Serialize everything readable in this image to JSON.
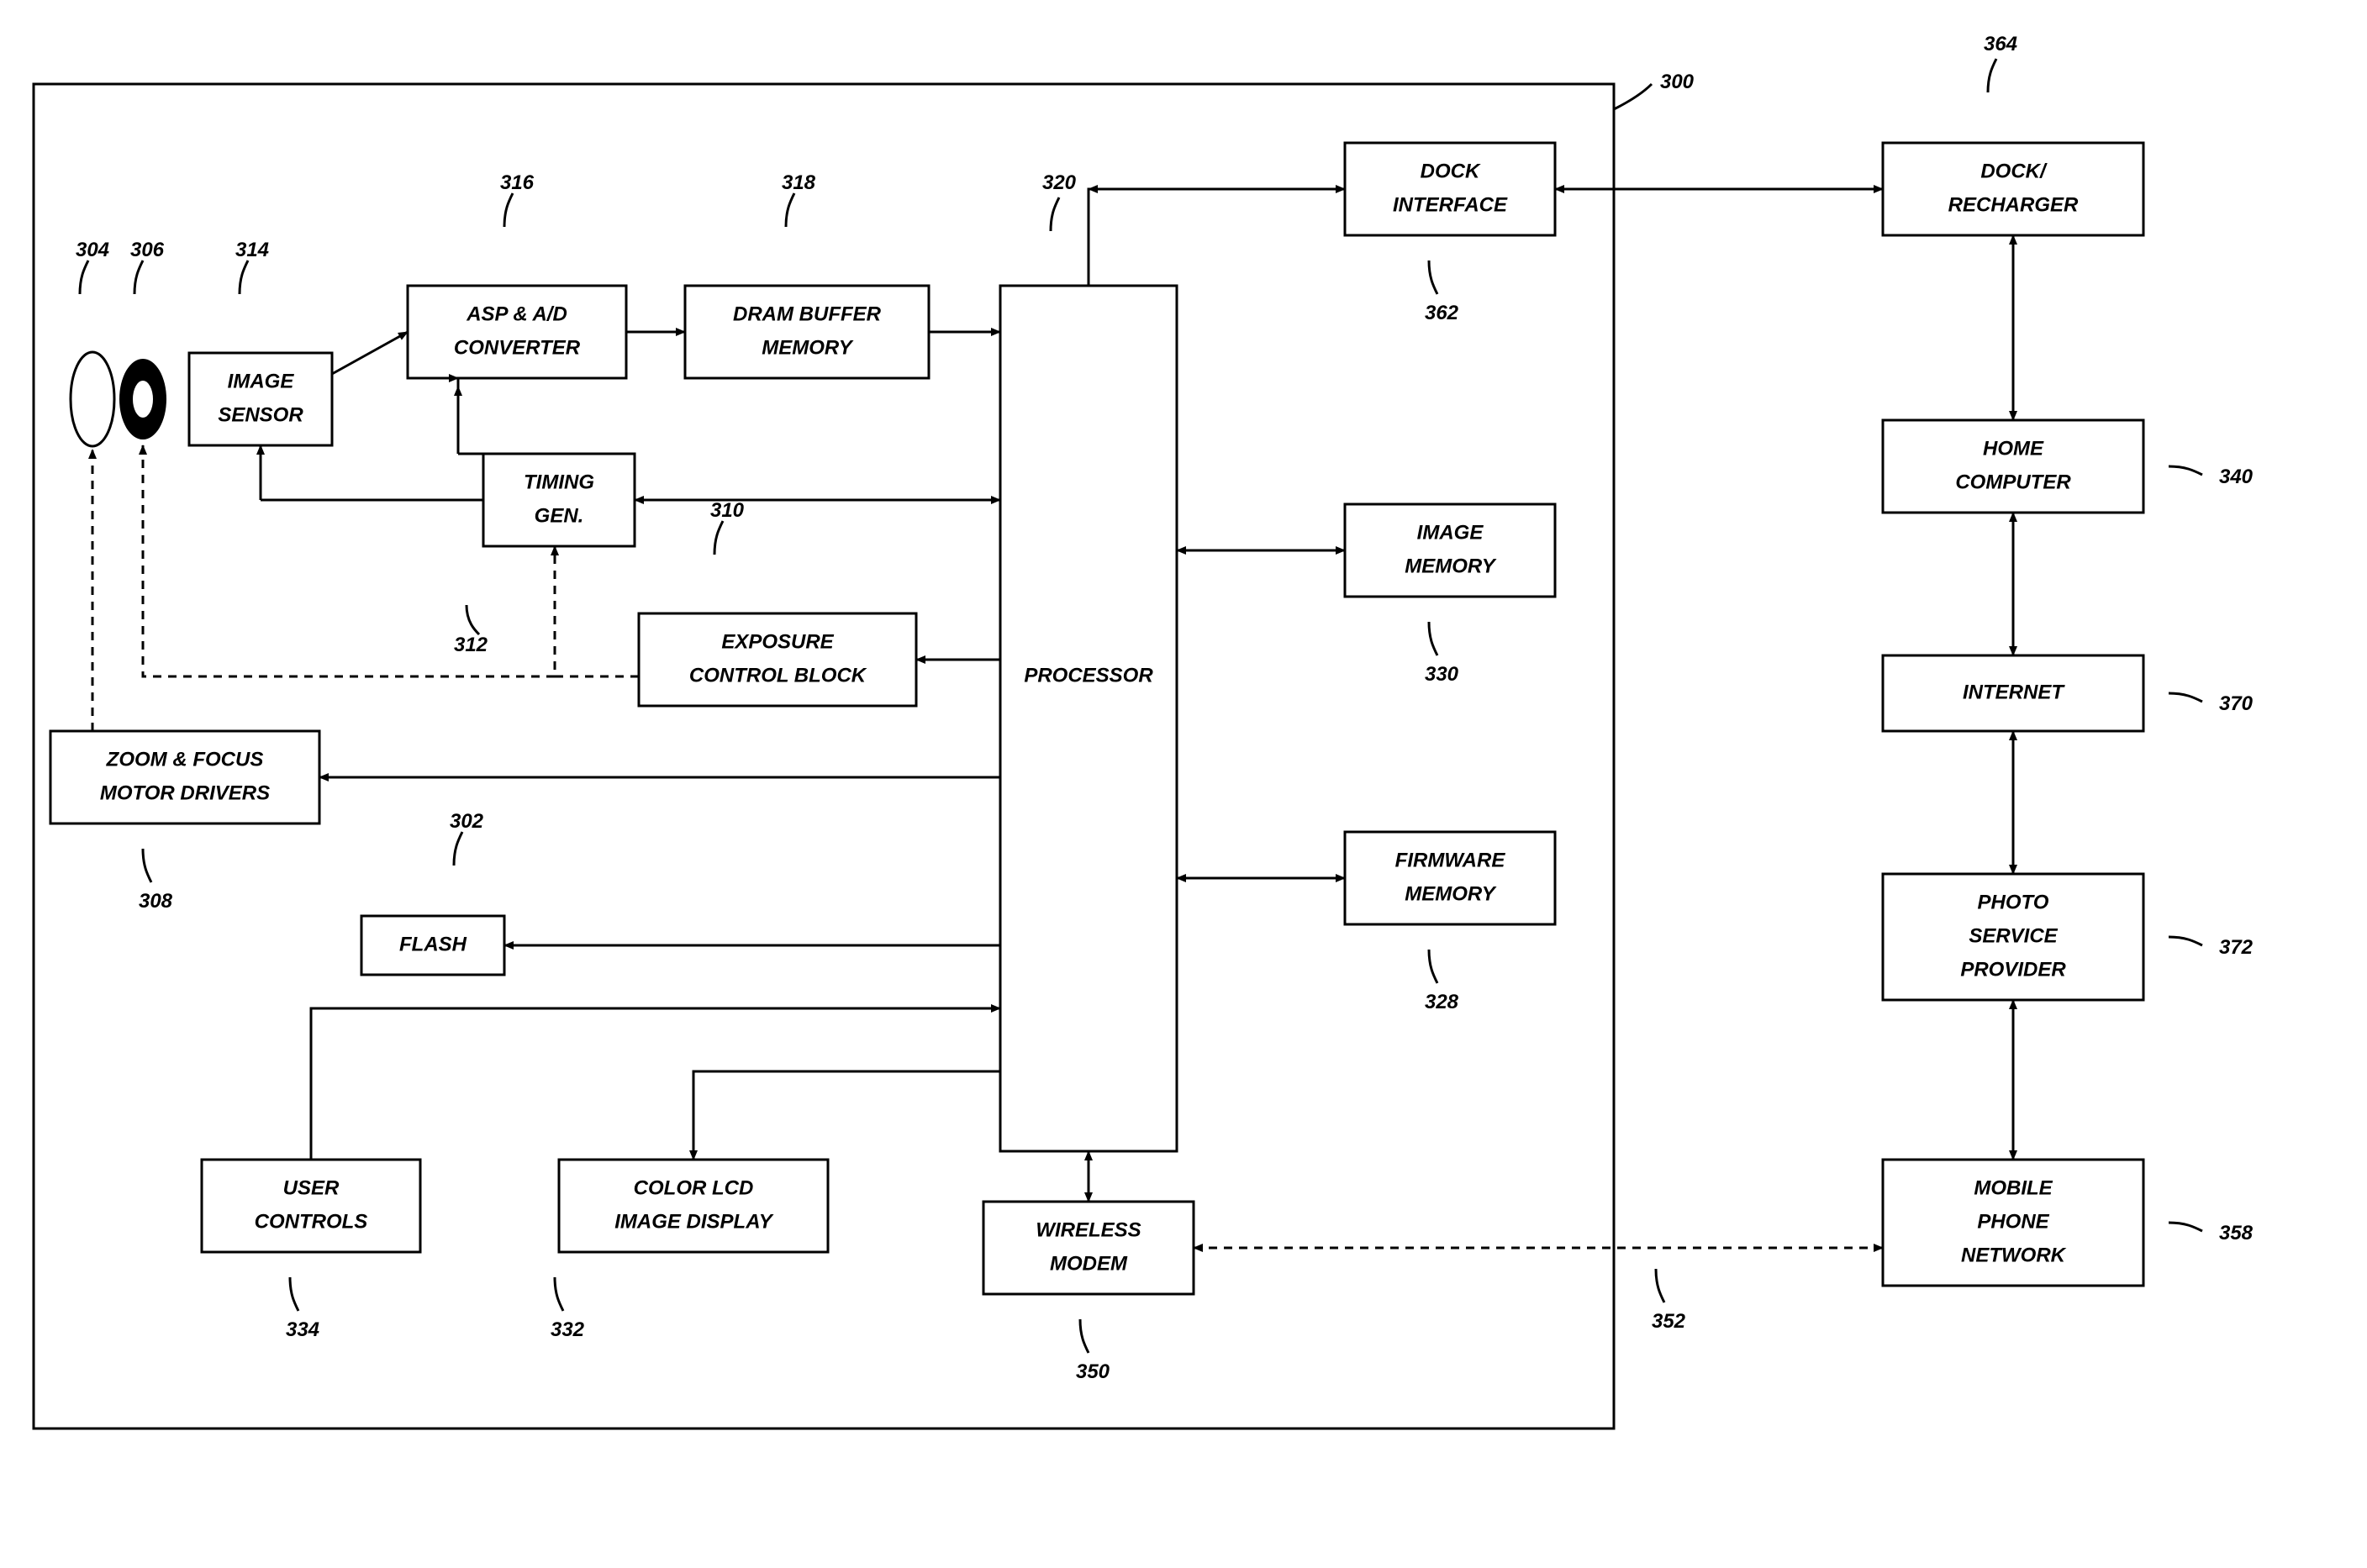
{
  "outer_ref": "300",
  "blocks": {
    "lens1": {
      "ref": "304"
    },
    "lens2": {
      "ref": "306"
    },
    "image_sensor": {
      "label1": "IMAGE",
      "label2": "SENSOR",
      "ref": "314"
    },
    "asp": {
      "label1": "ASP & A/D",
      "label2": "CONVERTER",
      "ref": "316"
    },
    "dram": {
      "label1": "DRAM BUFFER",
      "label2": "MEMORY",
      "ref": "318"
    },
    "timing": {
      "label1": "TIMING",
      "label2": "GEN.",
      "ref": "312"
    },
    "exposure": {
      "label1": "EXPOSURE",
      "label2": "CONTROL BLOCK",
      "ref": "310"
    },
    "zoom": {
      "label1": "ZOOM & FOCUS",
      "label2": "MOTOR DRIVERS",
      "ref": "308"
    },
    "flash": {
      "label": "FLASH",
      "ref": "302"
    },
    "processor": {
      "label": "PROCESSOR",
      "ref": "320"
    },
    "user": {
      "label1": "USER",
      "label2": "CONTROLS",
      "ref": "334"
    },
    "colorlcd": {
      "label1": "COLOR LCD",
      "label2": "IMAGE DISPLAY",
      "ref": "332"
    },
    "wireless": {
      "label1": "WIRELESS",
      "label2": "MODEM",
      "ref": "350"
    },
    "dockif": {
      "label1": "DOCK",
      "label2": "INTERFACE",
      "ref": "362"
    },
    "imagemem": {
      "label1": "IMAGE",
      "label2": "MEMORY",
      "ref": "330"
    },
    "firmware": {
      "label1": "FIRMWARE",
      "label2": "MEMORY",
      "ref": "328"
    },
    "dock": {
      "label1": "DOCK/",
      "label2": "RECHARGER",
      "ref": "364"
    },
    "home": {
      "label1": "HOME",
      "label2": "COMPUTER",
      "ref": "340"
    },
    "internet": {
      "label": "INTERNET",
      "ref": "370"
    },
    "psp": {
      "label1": "PHOTO",
      "label2": "SERVICE",
      "label3": "PROVIDER",
      "ref": "372"
    },
    "mobile": {
      "label1": "MOBILE",
      "label2": "PHONE",
      "label3": "NETWORK",
      "ref": "358"
    },
    "modemlink_ref": "352"
  }
}
